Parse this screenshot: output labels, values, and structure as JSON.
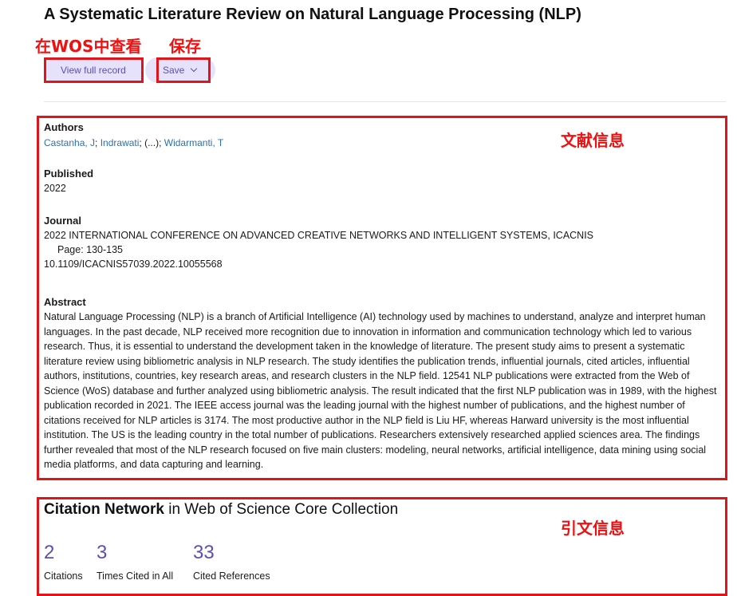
{
  "record": {
    "title": "A Systematic Literature Review on Natural Language Processing (NLP)"
  },
  "annotations": {
    "view_in_wos": "在WOS中查看",
    "save": "保存",
    "literature_info": "文献信息",
    "citation_info": "引文信息"
  },
  "toolbar": {
    "view_full_record_label": "View full record",
    "save_label": "Save",
    "save_icon": "chevron-down-icon"
  },
  "authors": {
    "label": "Authors",
    "list": [
      "Castanha, J",
      "Indrawati",
      "(...)",
      "Widarmanti, T"
    ],
    "separator": "; "
  },
  "published": {
    "label": "Published",
    "value": "2022"
  },
  "journal": {
    "label": "Journal",
    "name": "2022 INTERNATIONAL CONFERENCE ON ADVANCED CREATIVE NETWORKS AND INTELLIGENT SYSTEMS, ICACNIS",
    "pages": "Page: 130-135",
    "doi": "10.1109/ICACNIS57039.2022.10055568"
  },
  "abstract": {
    "label": "Abstract",
    "text": "Natural Language Processing (NLP) is a branch of Artificial Intelligence (AI) technology used by machines to understand, analyze and interpret human languages. In the past decade, NLP received more recognition due to innovation in information and communication technology which led to various research. Thus, it is essential to understand the development taken in the knowledge of literature. The present study aims to present a systematic literature review using bibliometric analysis in NLP research. The study identifies the publication trends, influential journals, cited articles, influential authors, institutions, countries, key research areas, and research clusters in the NLP field. 12541 NLP publications were extracted from the Web of Science (WoS) database and further analyzed using bibliometric analysis. The result indicated that the first NLP publication was in 1989, with the highest publication recorded in 2021. The IEEE access journal was the leading journal with the highest number of publications, and the highest number of citations received for NLP articles is 3174. The most productive author in the NLP field is Liu HF, whereas Harward university is the most influential institution. The US is the leading country in the total number of publications. Researchers extensively researched applied sciences area. The findings further revealed that most of the NLP research focused on five main clusters: modeling, neural networks, artificial intelligence, data mining using social media platforms, and data capturing and learning."
  },
  "citation_network": {
    "title_bold": "Citation Network",
    "title_rest": " in Web of Science Core Collection",
    "metrics": [
      {
        "value": "2",
        "label": "Citations"
      },
      {
        "value": "3",
        "label": "Times Cited in All"
      },
      {
        "value": "33",
        "label": "Cited References"
      }
    ]
  },
  "colors": {
    "annotation_red": "#e0151b",
    "accent_purple": "#5b4fb5",
    "button_bg": "#e7e2fb",
    "link_blue": "#2e6fb3"
  }
}
